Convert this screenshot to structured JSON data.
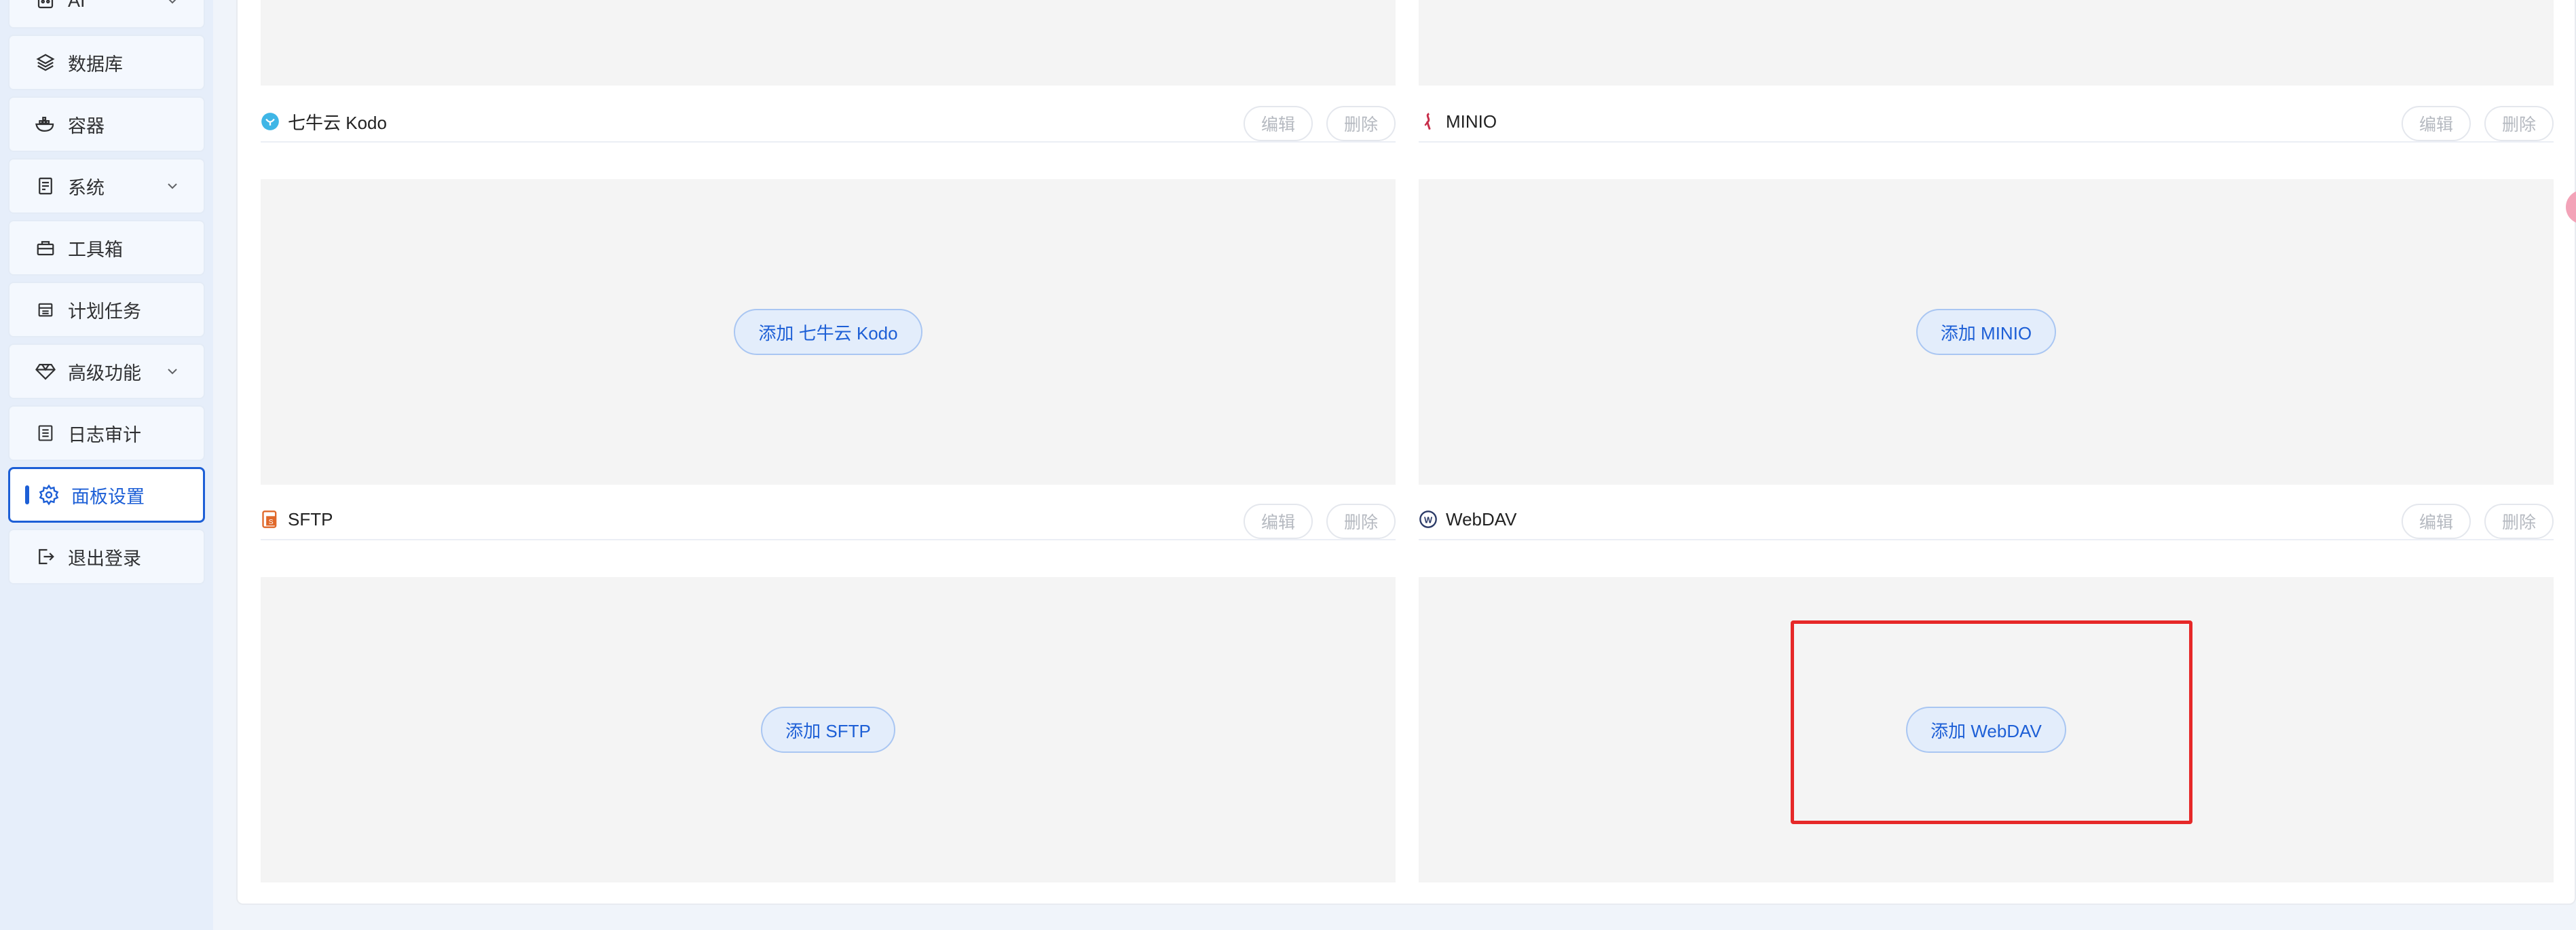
{
  "sidebar": {
    "items": [
      {
        "label": "AI",
        "icon": "robot-icon",
        "has_children": true
      },
      {
        "label": "数据库",
        "icon": "layers-icon",
        "has_children": false
      },
      {
        "label": "容器",
        "icon": "docker-icon",
        "has_children": false
      },
      {
        "label": "系统",
        "icon": "server-icon",
        "has_children": true
      },
      {
        "label": "工具箱",
        "icon": "toolbox-icon",
        "has_children": false
      },
      {
        "label": "计划任务",
        "icon": "calendar-icon",
        "has_children": false
      },
      {
        "label": "高级功能",
        "icon": "diamond-icon",
        "has_children": true
      },
      {
        "label": "日志审计",
        "icon": "log-icon",
        "has_children": false
      },
      {
        "label": "面板设置",
        "icon": "gear-icon",
        "has_children": false,
        "active": true
      },
      {
        "label": "退出登录",
        "icon": "logout-icon",
        "has_children": false
      }
    ]
  },
  "storage": {
    "qiniu": {
      "title": "七牛云 Kodo",
      "edit": "编辑",
      "delete": "删除",
      "add": "添加 七牛云 Kodo"
    },
    "minio": {
      "title": "MINIO",
      "edit": "编辑",
      "delete": "删除",
      "add": "添加 MINIO"
    },
    "sftp": {
      "title": "SFTP",
      "edit": "编辑",
      "delete": "删除",
      "add": "添加 SFTP"
    },
    "webdav": {
      "title": "WebDAV",
      "edit": "编辑",
      "delete": "删除",
      "add": "添加 WebDAV"
    }
  },
  "colors": {
    "accent": "#1d5fd6",
    "highlight": "#e62828"
  }
}
